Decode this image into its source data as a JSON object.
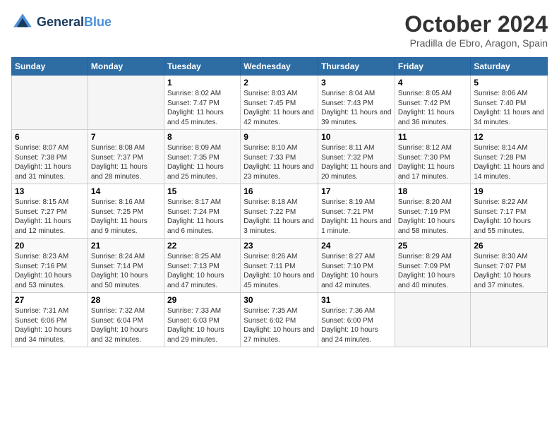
{
  "header": {
    "logo_line1": "General",
    "logo_line2": "Blue",
    "month": "October 2024",
    "location": "Pradilla de Ebro, Aragon, Spain"
  },
  "days_of_week": [
    "Sunday",
    "Monday",
    "Tuesday",
    "Wednesday",
    "Thursday",
    "Friday",
    "Saturday"
  ],
  "weeks": [
    [
      {
        "day": "",
        "empty": true
      },
      {
        "day": "",
        "empty": true
      },
      {
        "day": "1",
        "sunrise": "8:02 AM",
        "sunset": "7:47 PM",
        "daylight": "11 hours and 45 minutes."
      },
      {
        "day": "2",
        "sunrise": "8:03 AM",
        "sunset": "7:45 PM",
        "daylight": "11 hours and 42 minutes."
      },
      {
        "day": "3",
        "sunrise": "8:04 AM",
        "sunset": "7:43 PM",
        "daylight": "11 hours and 39 minutes."
      },
      {
        "day": "4",
        "sunrise": "8:05 AM",
        "sunset": "7:42 PM",
        "daylight": "11 hours and 36 minutes."
      },
      {
        "day": "5",
        "sunrise": "8:06 AM",
        "sunset": "7:40 PM",
        "daylight": "11 hours and 34 minutes."
      }
    ],
    [
      {
        "day": "6",
        "sunrise": "8:07 AM",
        "sunset": "7:38 PM",
        "daylight": "11 hours and 31 minutes."
      },
      {
        "day": "7",
        "sunrise": "8:08 AM",
        "sunset": "7:37 PM",
        "daylight": "11 hours and 28 minutes."
      },
      {
        "day": "8",
        "sunrise": "8:09 AM",
        "sunset": "7:35 PM",
        "daylight": "11 hours and 25 minutes."
      },
      {
        "day": "9",
        "sunrise": "8:10 AM",
        "sunset": "7:33 PM",
        "daylight": "11 hours and 23 minutes."
      },
      {
        "day": "10",
        "sunrise": "8:11 AM",
        "sunset": "7:32 PM",
        "daylight": "11 hours and 20 minutes."
      },
      {
        "day": "11",
        "sunrise": "8:12 AM",
        "sunset": "7:30 PM",
        "daylight": "11 hours and 17 minutes."
      },
      {
        "day": "12",
        "sunrise": "8:14 AM",
        "sunset": "7:28 PM",
        "daylight": "11 hours and 14 minutes."
      }
    ],
    [
      {
        "day": "13",
        "sunrise": "8:15 AM",
        "sunset": "7:27 PM",
        "daylight": "11 hours and 12 minutes."
      },
      {
        "day": "14",
        "sunrise": "8:16 AM",
        "sunset": "7:25 PM",
        "daylight": "11 hours and 9 minutes."
      },
      {
        "day": "15",
        "sunrise": "8:17 AM",
        "sunset": "7:24 PM",
        "daylight": "11 hours and 6 minutes."
      },
      {
        "day": "16",
        "sunrise": "8:18 AM",
        "sunset": "7:22 PM",
        "daylight": "11 hours and 3 minutes."
      },
      {
        "day": "17",
        "sunrise": "8:19 AM",
        "sunset": "7:21 PM",
        "daylight": "11 hours and 1 minute."
      },
      {
        "day": "18",
        "sunrise": "8:20 AM",
        "sunset": "7:19 PM",
        "daylight": "10 hours and 58 minutes."
      },
      {
        "day": "19",
        "sunrise": "8:22 AM",
        "sunset": "7:17 PM",
        "daylight": "10 hours and 55 minutes."
      }
    ],
    [
      {
        "day": "20",
        "sunrise": "8:23 AM",
        "sunset": "7:16 PM",
        "daylight": "10 hours and 53 minutes."
      },
      {
        "day": "21",
        "sunrise": "8:24 AM",
        "sunset": "7:14 PM",
        "daylight": "10 hours and 50 minutes."
      },
      {
        "day": "22",
        "sunrise": "8:25 AM",
        "sunset": "7:13 PM",
        "daylight": "10 hours and 47 minutes."
      },
      {
        "day": "23",
        "sunrise": "8:26 AM",
        "sunset": "7:11 PM",
        "daylight": "10 hours and 45 minutes."
      },
      {
        "day": "24",
        "sunrise": "8:27 AM",
        "sunset": "7:10 PM",
        "daylight": "10 hours and 42 minutes."
      },
      {
        "day": "25",
        "sunrise": "8:29 AM",
        "sunset": "7:09 PM",
        "daylight": "10 hours and 40 minutes."
      },
      {
        "day": "26",
        "sunrise": "8:30 AM",
        "sunset": "7:07 PM",
        "daylight": "10 hours and 37 minutes."
      }
    ],
    [
      {
        "day": "27",
        "sunrise": "7:31 AM",
        "sunset": "6:06 PM",
        "daylight": "10 hours and 34 minutes."
      },
      {
        "day": "28",
        "sunrise": "7:32 AM",
        "sunset": "6:04 PM",
        "daylight": "10 hours and 32 minutes."
      },
      {
        "day": "29",
        "sunrise": "7:33 AM",
        "sunset": "6:03 PM",
        "daylight": "10 hours and 29 minutes."
      },
      {
        "day": "30",
        "sunrise": "7:35 AM",
        "sunset": "6:02 PM",
        "daylight": "10 hours and 27 minutes."
      },
      {
        "day": "31",
        "sunrise": "7:36 AM",
        "sunset": "6:00 PM",
        "daylight": "10 hours and 24 minutes."
      },
      {
        "day": "",
        "empty": true
      },
      {
        "day": "",
        "empty": true
      }
    ]
  ]
}
